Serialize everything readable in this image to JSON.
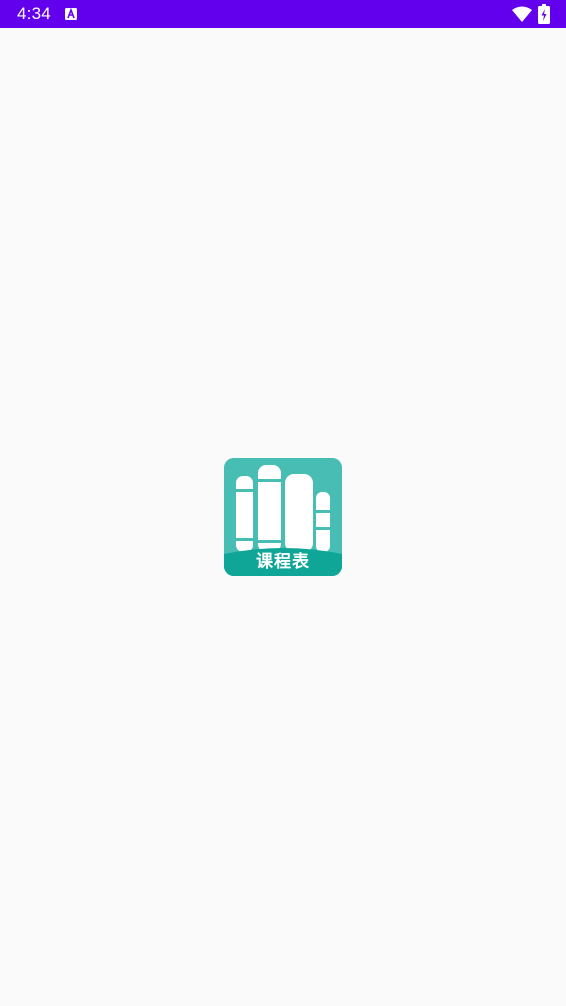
{
  "status_bar": {
    "time": "4:34",
    "background_color": "#6200ee",
    "icons": [
      "a-notification-icon",
      "wifi-icon",
      "battery-charging-icon"
    ]
  },
  "splash": {
    "background_color": "#fafafa",
    "logo": {
      "icon": "books-logo-icon",
      "caption": "课程表",
      "colors": {
        "tile": "#47bdb4",
        "base": "#0fa597",
        "books": "#ffffff"
      }
    }
  }
}
